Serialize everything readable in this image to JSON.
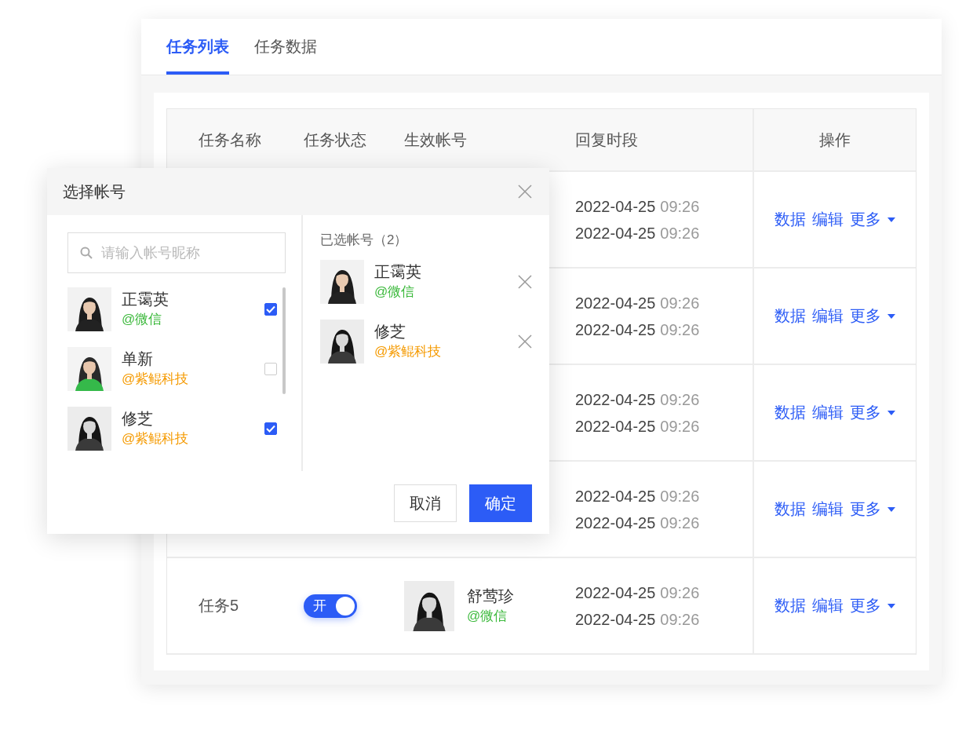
{
  "tabs": [
    {
      "label": "任务列表",
      "selected": true
    },
    {
      "label": "任务数据",
      "selected": false
    }
  ],
  "table": {
    "columns": [
      "任务名称",
      "任务状态",
      "生效帐号",
      "回复时段",
      "操作"
    ],
    "rows": [
      {
        "times": [
          {
            "date": "2022-04-25",
            "time": "09:26"
          },
          {
            "date": "2022-04-25",
            "time": "09:26"
          }
        ],
        "actions": [
          "数据",
          "编辑",
          "更多"
        ]
      },
      {
        "times": [
          {
            "date": "2022-04-25",
            "time": "09:26"
          },
          {
            "date": "2022-04-25",
            "time": "09:26"
          }
        ],
        "actions": [
          "数据",
          "编辑",
          "更多"
        ]
      },
      {
        "times": [
          {
            "date": "2022-04-25",
            "time": "09:26"
          },
          {
            "date": "2022-04-25",
            "time": "09:26"
          }
        ],
        "actions": [
          "数据",
          "编辑",
          "更多"
        ]
      },
      {
        "times": [
          {
            "date": "2022-04-25",
            "time": "09:26"
          },
          {
            "date": "2022-04-25",
            "time": "09:26"
          }
        ],
        "actions": [
          "数据",
          "编辑",
          "更多"
        ]
      },
      {
        "name": "任务5",
        "status": {
          "label": "开",
          "on": true
        },
        "account": {
          "name": "舒莺珍",
          "source": "@微信",
          "color": "#3cb93c"
        },
        "times": [
          {
            "date": "2022-04-25",
            "time": "09:26"
          },
          {
            "date": "2022-04-25",
            "time": "09:26"
          }
        ],
        "actions": [
          "数据",
          "编辑",
          "更多"
        ]
      }
    ]
  },
  "dialog": {
    "title": "选择帐号",
    "search": {
      "placeholder": "请输入帐号昵称"
    },
    "accounts": [
      {
        "name": "正霭英",
        "source": "@微信",
        "color": "#3cb93c",
        "checked": true
      },
      {
        "name": "单新",
        "source": "@紫鲲科技",
        "color": "#f59a00",
        "checked": false
      },
      {
        "name": "修芝",
        "source": "@紫鲲科技",
        "color": "#f59a00",
        "checked": true
      }
    ],
    "selected_title": "已选帐号（2）",
    "selected": [
      {
        "name": "正霭英",
        "source": "@微信",
        "color": "#3cb93c"
      },
      {
        "name": "修芝",
        "source": "@紫鲲科技",
        "color": "#f59a00"
      }
    ],
    "buttons": [
      {
        "label": "取消",
        "kind": "secondary"
      },
      {
        "label": "确定",
        "kind": "primary"
      }
    ]
  }
}
